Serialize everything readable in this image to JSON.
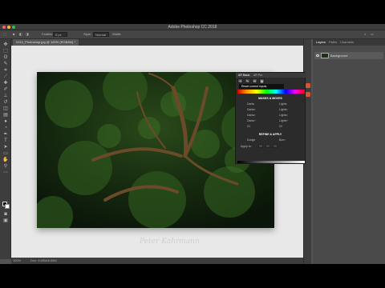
{
  "app": {
    "title": "Adobe Photoshop CC 2018",
    "document_tab": "0310_Photoshop.jpg @ 100% (RGB/8#) *"
  },
  "options_bar": {
    "feather_label": "Feather:",
    "feather_value": "0 px",
    "style_label": "Style:",
    "style_value": "Normal",
    "width_label": "Width:"
  },
  "status": {
    "zoom": "100%",
    "doc_info": "Doc: 8.65M/8.65M"
  },
  "layers_panel": {
    "tabs": [
      "Layers",
      "Paths",
      "Channels"
    ],
    "active_tab": "Layers",
    "layer_name": "Background"
  },
  "ar_panel": {
    "tabs": [
      "AR Basic",
      "AR Pro"
    ],
    "tooltip": "Reset current inputs",
    "masks_title": "MASKS & MOVES",
    "labels": [
      "Darks",
      "Lights",
      "Darks²",
      "Lights²",
      "Darks³",
      "Lights³",
      "Darks⁴",
      "Lights⁴",
      "Z1",
      "Z2"
    ],
    "refine_title": "REFINE & APPLY",
    "refine_labels": [
      "Dodge",
      "Burn"
    ],
    "apply_label": "Apply to:"
  },
  "colors": {
    "accent": "#d3562c",
    "photo_bg": "#0f200c"
  },
  "signature": "Peter Kahrmann"
}
